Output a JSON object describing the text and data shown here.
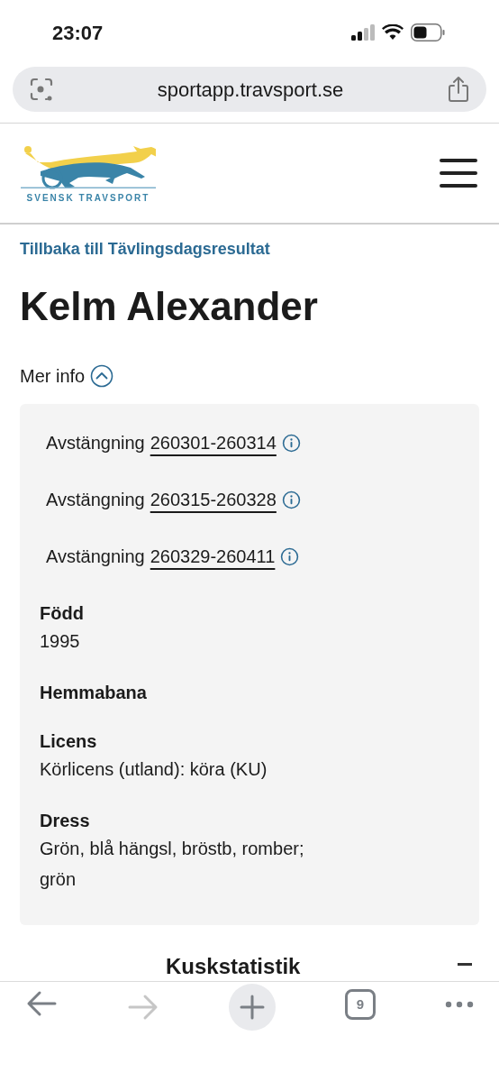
{
  "status_bar": {
    "time": "23:07"
  },
  "browser": {
    "url": "sportapp.travsport.se",
    "tab_count": "9",
    "back_disabled": false,
    "forward_disabled": true
  },
  "header": {
    "logo_text": "SVENSK TRAVSPORT"
  },
  "back_link": "Tillbaka till Tävlingsdagsresultat",
  "title": "Kelm Alexander",
  "more_info": {
    "label": "Mer info",
    "expanded": true
  },
  "suspensions": [
    {
      "label": "Avstängning",
      "period": "260301-260314"
    },
    {
      "label": "Avstängning",
      "period": "260315-260328"
    },
    {
      "label": "Avstängning",
      "period": "260329-260411"
    }
  ],
  "fields": [
    {
      "label": "Född",
      "lines": [
        "1995"
      ]
    },
    {
      "label": "Hemmabana"
    },
    {
      "label": "Licens",
      "lines": [
        "Körlicens (utland): köra (KU)"
      ]
    },
    {
      "label": "Dress",
      "lines": [
        "Grön, blå hängsl, bröstb, romber;",
        "grön"
      ]
    }
  ],
  "next_section": {
    "title": "Kuskstatistik",
    "expanded": true
  }
}
